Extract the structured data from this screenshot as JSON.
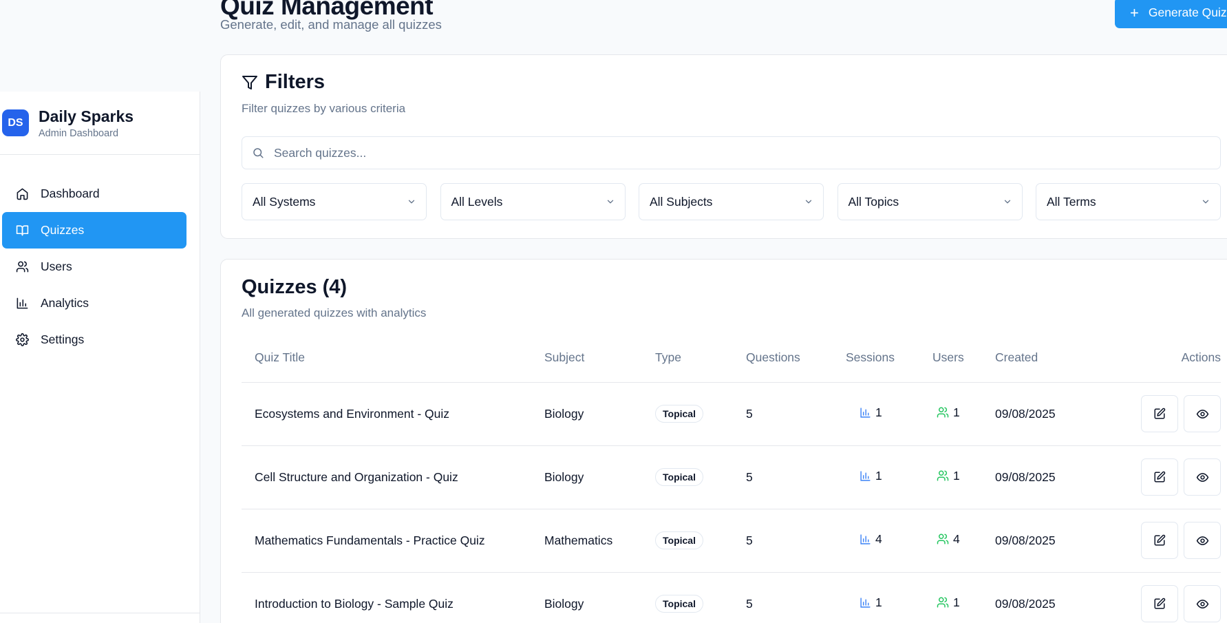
{
  "header": {
    "title": "Quiz Management",
    "subtitle": "Generate, edit, and manage all quizzes",
    "generate_label": "Generate Quiz"
  },
  "sidebar": {
    "brand_initials": "DS",
    "brand_name": "Daily Sparks",
    "brand_sub": "Admin Dashboard",
    "items": [
      {
        "label": "Dashboard",
        "icon": "home-icon",
        "active": false
      },
      {
        "label": "Quizzes",
        "icon": "book-open-icon",
        "active": true
      },
      {
        "label": "Users",
        "icon": "users-icon",
        "active": false
      },
      {
        "label": "Analytics",
        "icon": "bar-chart-icon",
        "active": false
      },
      {
        "label": "Settings",
        "icon": "gear-icon",
        "active": false
      }
    ]
  },
  "filters": {
    "title": "Filters",
    "subtitle": "Filter quizzes by various criteria",
    "search_placeholder": "Search quizzes...",
    "selects": [
      "All Systems",
      "All Levels",
      "All Subjects",
      "All Topics",
      "All Terms"
    ]
  },
  "quizzes": {
    "title": "Quizzes (4)",
    "subtitle": "All generated quizzes with analytics",
    "columns": [
      "Quiz Title",
      "Subject",
      "Type",
      "Questions",
      "Sessions",
      "Users",
      "Created",
      "Actions"
    ],
    "rows": [
      {
        "title": "Ecosystems and Environment - Quiz",
        "subject": "Biology",
        "type": "Topical",
        "questions": "5",
        "sessions": "1",
        "users": "1",
        "created": "09/08/2025"
      },
      {
        "title": "Cell Structure and Organization - Quiz",
        "subject": "Biology",
        "type": "Topical",
        "questions": "5",
        "sessions": "1",
        "users": "1",
        "created": "09/08/2025"
      },
      {
        "title": "Mathematics Fundamentals - Practice Quiz",
        "subject": "Mathematics",
        "type": "Topical",
        "questions": "5",
        "sessions": "4",
        "users": "4",
        "created": "09/08/2025"
      },
      {
        "title": "Introduction to Biology - Sample Quiz",
        "subject": "Biology",
        "type": "Topical",
        "questions": "5",
        "sessions": "1",
        "users": "1",
        "created": "09/08/2025"
      }
    ]
  },
  "colors": {
    "accent": "#2196f3",
    "brand": "#2563eb",
    "sessions_icon": "#3b82f6",
    "users_icon": "#22c55e"
  }
}
